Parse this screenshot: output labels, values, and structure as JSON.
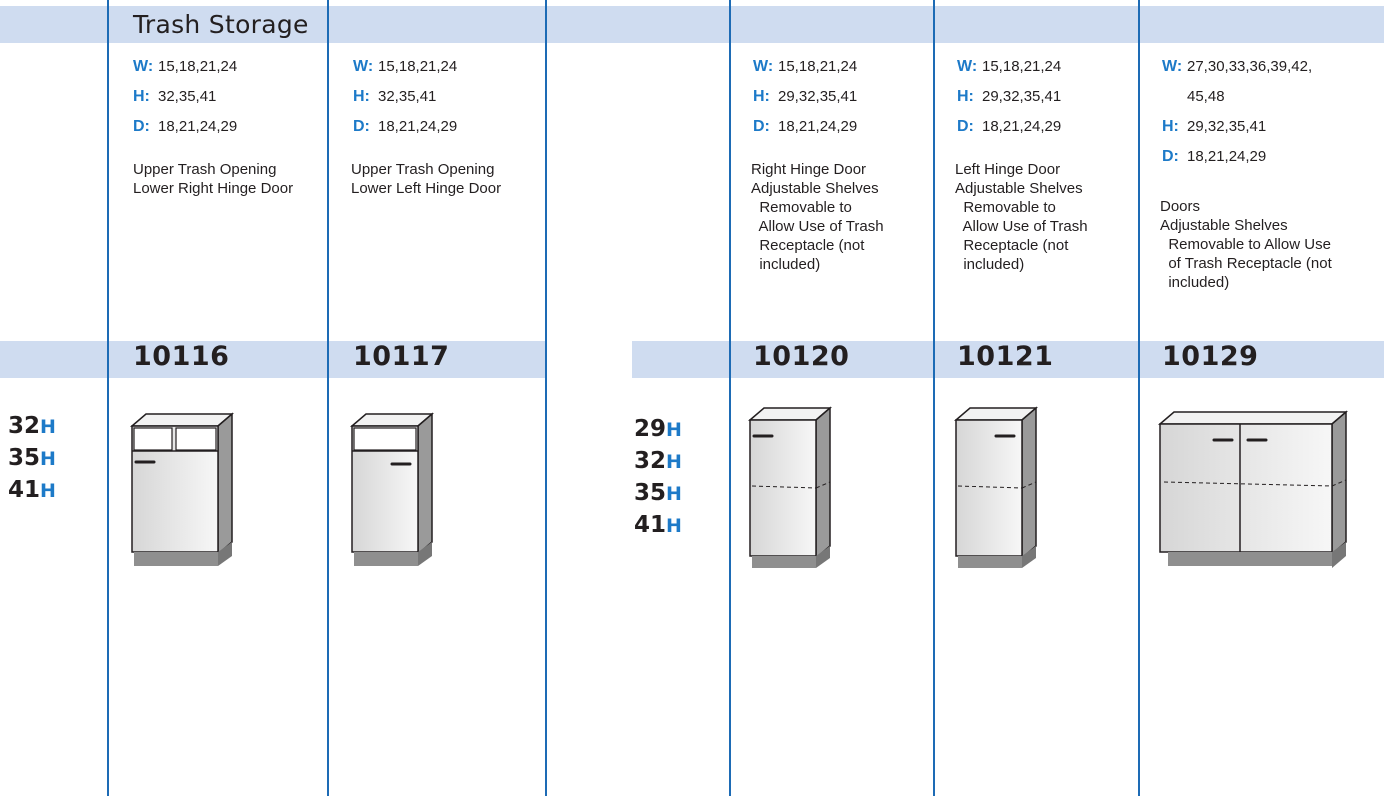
{
  "section": {
    "title": "Trash Storage"
  },
  "height_groups": [
    {
      "items": [
        {
          "num": "32",
          "unit": "H"
        },
        {
          "num": "35",
          "unit": "H"
        },
        {
          "num": "41",
          "unit": "H"
        }
      ]
    },
    {
      "items": [
        {
          "num": "29",
          "unit": "H"
        },
        {
          "num": "32",
          "unit": "H"
        },
        {
          "num": "35",
          "unit": "H"
        },
        {
          "num": "41",
          "unit": "H"
        }
      ]
    }
  ],
  "products": [
    {
      "code": "10116",
      "w_label": "W:",
      "w": "15,18,21,24",
      "h_label": "H:",
      "h": "32,35,41",
      "d_label": "D:",
      "d": "18,21,24,29",
      "description": "Upper Trash Opening\nLower Right Hinge Door",
      "illustration": "trash-opening-cabinet-right-hinge"
    },
    {
      "code": "10117",
      "w_label": "W:",
      "w": "15,18,21,24",
      "h_label": "H:",
      "h": "32,35,41",
      "d_label": "D:",
      "d": "18,21,24,29",
      "description": "Upper Trash Opening\nLower Left Hinge Door",
      "illustration": "trash-opening-cabinet-left-hinge"
    },
    {
      "code": "10120",
      "w_label": "W:",
      "w": "15,18,21,24",
      "h_label": "H:",
      "h": "29,32,35,41",
      "d_label": "D:",
      "d": "18,21,24,29",
      "description": "Right Hinge Door\nAdjustable Shelves\n  Removable to\n  Allow Use of Trash\n  Receptacle (not\n  included)",
      "illustration": "single-door-cabinet"
    },
    {
      "code": "10121",
      "w_label": "W:",
      "w": "15,18,21,24",
      "h_label": "H:",
      "h": "29,32,35,41",
      "d_label": "D:",
      "d": "18,21,24,29",
      "description": "Left Hinge Door\nAdjustable Shelves\n  Removable to\n  Allow Use of Trash\n  Receptacle (not\n  included)",
      "illustration": "single-door-cabinet"
    },
    {
      "code": "10129",
      "w_label": "W:",
      "w": "27,30,33,36,39,42,",
      "w2": "45,48",
      "h_label": "H:",
      "h": "29,32,35,41",
      "d_label": "D:",
      "d": "18,21,24,29",
      "description": "Doors\nAdjustable Shelves\n  Removable to Allow Use\n  of Trash Receptacle (not\n  included)",
      "illustration": "double-door-cabinet"
    }
  ],
  "colors": {
    "band": "#cfdcf0",
    "accent": "#1d7ac8",
    "rule": "#1d6bb5"
  }
}
